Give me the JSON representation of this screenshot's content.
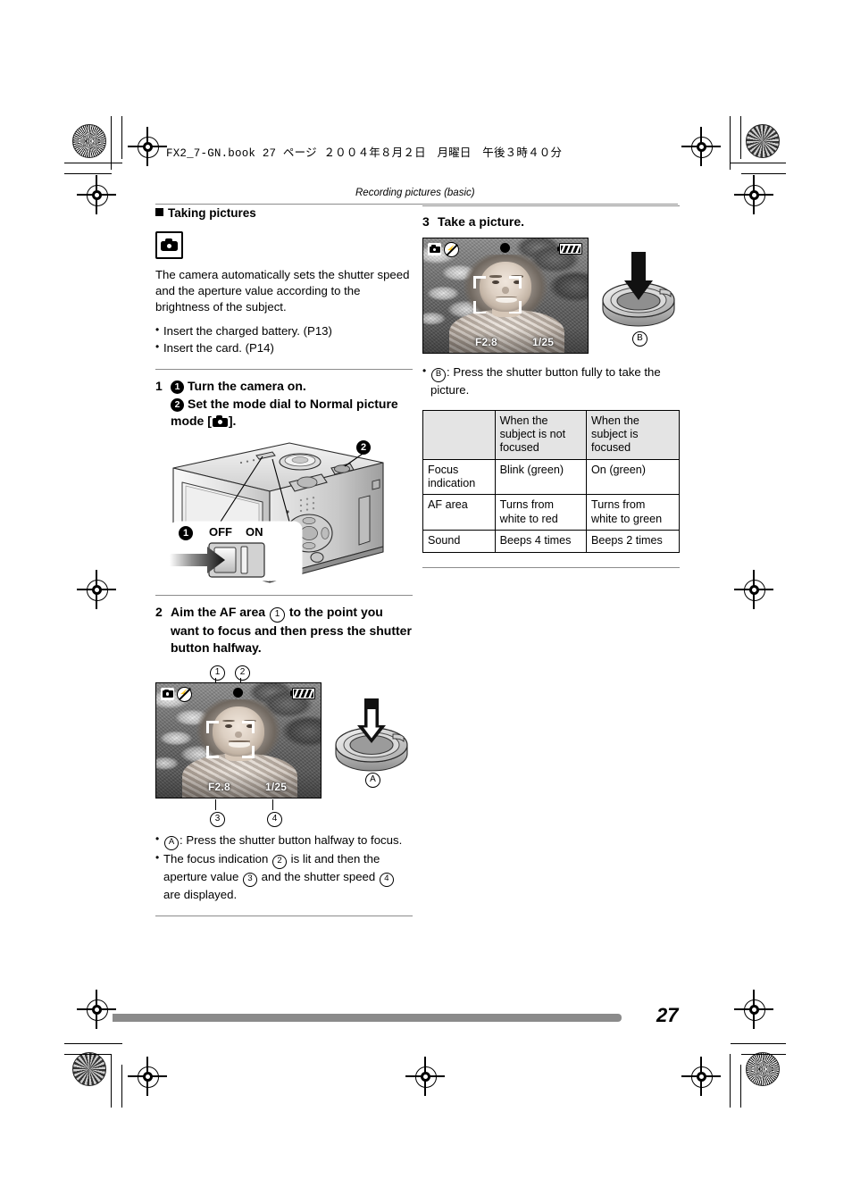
{
  "page": {
    "file_header": "FX2_7-GN.book  27 ページ  ２００４年８月２日　月曜日　午後３時４０分",
    "running_header": "Recording pictures (basic)",
    "page_number": "27"
  },
  "left_column": {
    "section_heading": "Taking pictures",
    "mode_icon": "normal-picture-mode-icon",
    "intro": "The camera automatically sets the shutter speed and the aperture value according to the brightness of the subject.",
    "bullets": [
      "Insert the charged battery. (P13)",
      "Insert the card. (P14)"
    ],
    "step1": {
      "number": "1",
      "sub1_marker": "1",
      "sub1_text": "Turn the camera on.",
      "sub2_marker": "2",
      "sub2_text_a": "Set the mode dial to Normal picture mode [",
      "sub2_text_b": "].",
      "figure": {
        "switch_off_label": "OFF",
        "switch_on_label": "ON",
        "callout_1": "1",
        "callout_2": "2"
      }
    },
    "step2": {
      "number": "2",
      "text_a": "Aim the AF area ",
      "ref_1": "1",
      "text_b": " to the point you want to focus and then press the shutter button halfway.",
      "lcd_callouts": {
        "top_left": "1",
        "top_right": "2",
        "bottom_left": "3",
        "bottom_right": "4"
      },
      "lcd": {
        "aperture": "F2.8",
        "shutter_speed": "1/25",
        "icons": [
          "rec-mode-icon",
          "flash-off-icon",
          "focus-indication-dot",
          "battery-icon"
        ]
      },
      "shutter_callout": "A",
      "notes": [
        {
          "marker": "A",
          "text": ":  Press the shutter button halfway to focus."
        }
      ],
      "note2_parts": {
        "a": "The focus indication ",
        "r1": "2",
        "b": " is lit and then the aperture value ",
        "r2": "3",
        "c": " and the shutter speed ",
        "r3": "4",
        "d": " are displayed."
      }
    }
  },
  "right_column": {
    "step3": {
      "number": "3",
      "text": "Take a picture.",
      "lcd": {
        "aperture": "F2.8",
        "shutter_speed": "1/25",
        "icons": [
          "rec-mode-icon",
          "flash-off-icon",
          "focus-indication-dot",
          "battery-icon"
        ]
      },
      "shutter_callout": "B",
      "note_marker": "B",
      "note_text": ":  Press the shutter button fully to take the picture."
    },
    "table": {
      "headers": [
        "",
        "When the subject is not focused",
        "When the subject is focused"
      ],
      "rows": [
        {
          "label": "Focus indication",
          "not_focused": "Blink (green)",
          "focused": "On (green)"
        },
        {
          "label": "AF area",
          "not_focused": "Turns from white to red",
          "focused": "Turns from white to green"
        },
        {
          "label": "Sound",
          "not_focused": "Beeps 4 times",
          "focused": "Beeps 2 times"
        }
      ]
    }
  }
}
